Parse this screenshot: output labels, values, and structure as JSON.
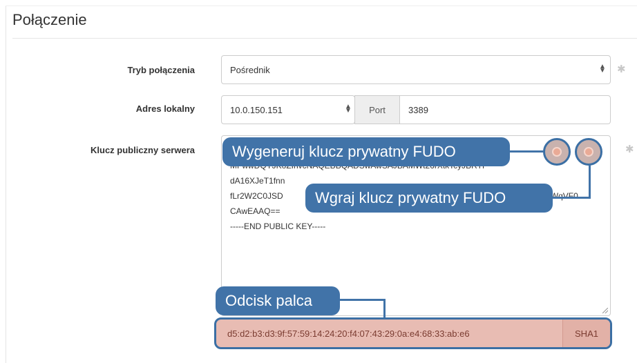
{
  "section": {
    "title": "Połączenie"
  },
  "fields": {
    "mode": {
      "label": "Tryb połączenia",
      "value": "Pośrednik"
    },
    "local_address": {
      "label": "Adres lokalny",
      "value": "10.0.150.151",
      "port_label": "Port",
      "port_value": "3389"
    },
    "public_key": {
      "label": "Klucz publiczny serwera",
      "lines": [
        "MFwwDQYJKoZIhvcNAQEBBQADSwAwSAJBAMWt26rXtkTcyJBRTP",
        "dA16XJeT1fnn",
        "fLr2W2C0JSD",
        "CAwEAAQ==",
        "-----END PUBLIC KEY-----"
      ],
      "line3_tail": "LWqVF0"
    },
    "fingerprint": {
      "value": "d5:d2:b3:d3:9f:57:59:14:24:20:f4:07:43:29:0a:e4:68:33:ab:e6",
      "algo": "SHA1"
    }
  },
  "callouts": {
    "generate": "Wygeneruj klucz prywatny FUDO",
    "upload": "Wgraj klucz prywatny FUDO",
    "fingerprint": "Odcisk palca"
  },
  "icons": {
    "required": "asterisk-icon",
    "generate_button": "generate-key-icon",
    "upload_button": "upload-key-icon",
    "select_arrows": "updown-arrows-icon"
  },
  "colors": {
    "callout": "#4173a8",
    "fingerprint_bg": "#e8bcb3"
  }
}
